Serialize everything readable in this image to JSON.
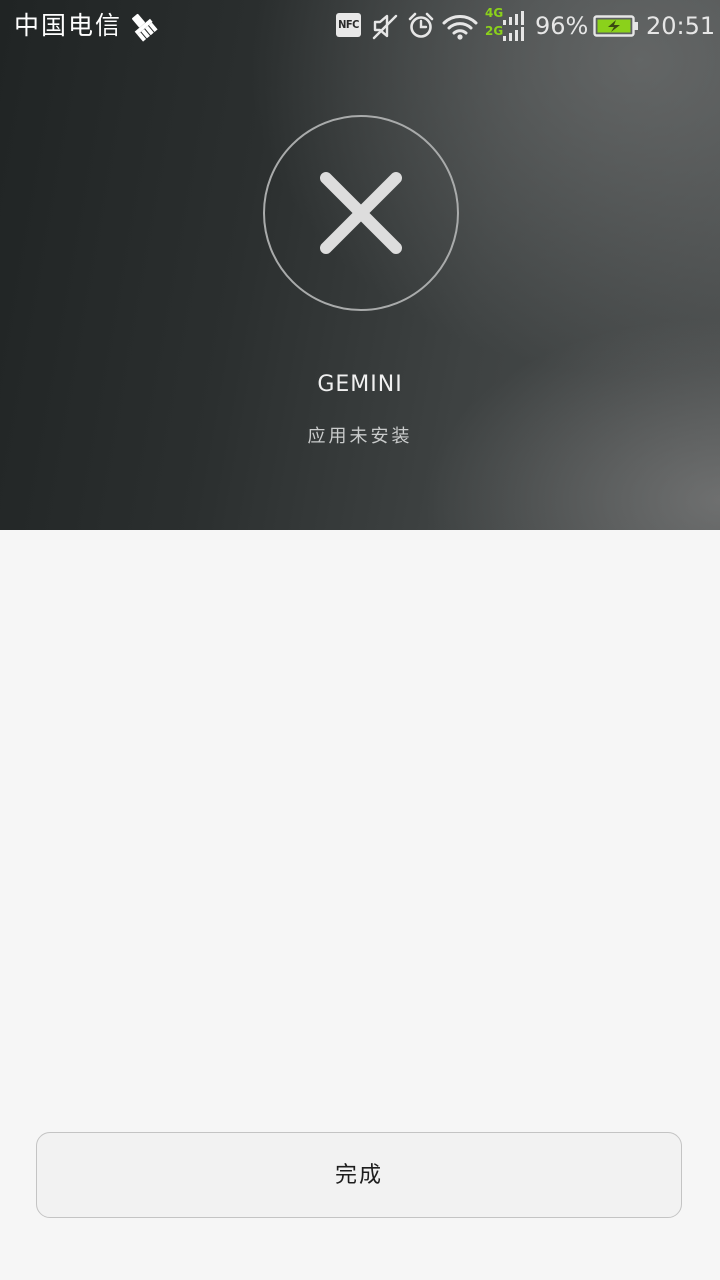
{
  "status_bar": {
    "carrier": "中国电信",
    "nfc_label": "NFC",
    "network_top": "4G",
    "network_bottom": "2G",
    "battery_percent": "96%",
    "time": "20:51",
    "icons": [
      "broom-icon",
      "nfc-icon",
      "mute-icon",
      "alarm-icon",
      "wifi-icon",
      "signal-icon",
      "battery-icon"
    ],
    "accent_color": "#8bd11b"
  },
  "install_result": {
    "status_icon": "close-icon",
    "app_name": "GEMINI",
    "status_message": "应用未安装"
  },
  "actions": {
    "done_label": "完成"
  },
  "colors": {
    "header_gradient_dark": "#202424",
    "header_gradient_light": "#4a4d4d",
    "page_background": "#f6f6f6",
    "battery_fill": "#8bd11b"
  }
}
